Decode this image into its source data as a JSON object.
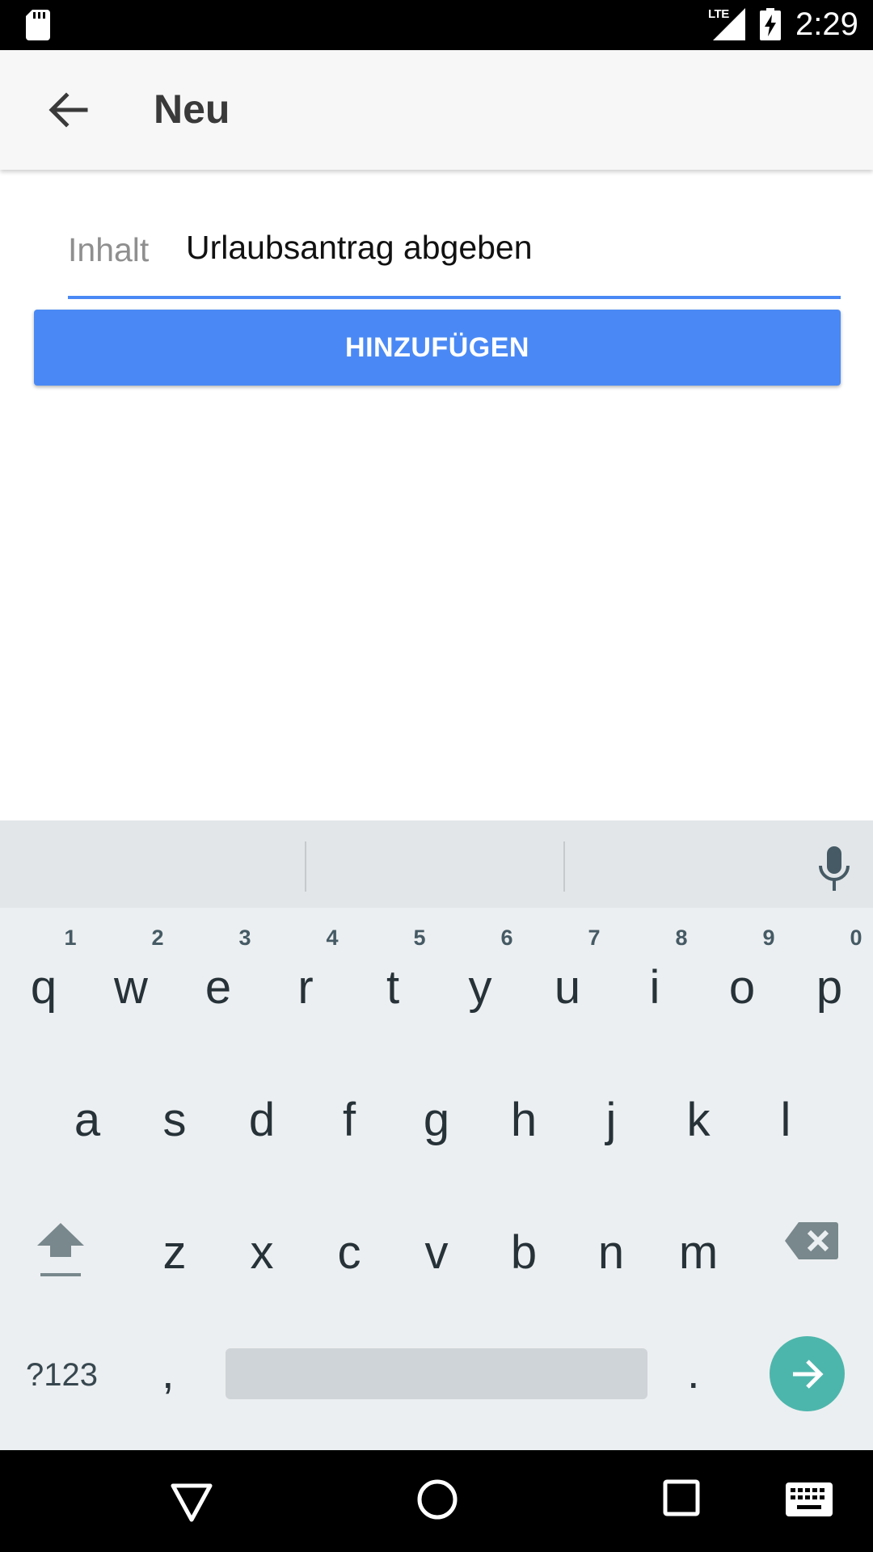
{
  "status_bar": {
    "network": "LTE",
    "time": "2:29",
    "icons": [
      "sd-card-icon",
      "signal-icon",
      "battery-charging-icon"
    ]
  },
  "app_bar": {
    "title": "Neu",
    "back_icon": "arrow-back-icon"
  },
  "form": {
    "field_label": "Inhalt",
    "field_value": "Urlaubsantrag abgeben",
    "submit_label": "HINZUFÜGEN",
    "accent_color": "#4a89f5"
  },
  "keyboard": {
    "row1": [
      {
        "key": "q",
        "hint": "1"
      },
      {
        "key": "w",
        "hint": "2"
      },
      {
        "key": "e",
        "hint": "3"
      },
      {
        "key": "r",
        "hint": "4"
      },
      {
        "key": "t",
        "hint": "5"
      },
      {
        "key": "y",
        "hint": "6"
      },
      {
        "key": "u",
        "hint": "7"
      },
      {
        "key": "i",
        "hint": "8"
      },
      {
        "key": "o",
        "hint": "9"
      },
      {
        "key": "p",
        "hint": "0"
      }
    ],
    "row2": [
      "a",
      "s",
      "d",
      "f",
      "g",
      "h",
      "j",
      "k",
      "l"
    ],
    "row3": [
      "z",
      "x",
      "c",
      "v",
      "b",
      "n",
      "m"
    ],
    "symbols_label": "?123",
    "comma": ",",
    "period": ".",
    "enter_color": "#4db6ac"
  },
  "nav_bar": {
    "icons": [
      "nav-back-icon",
      "nav-home-icon",
      "nav-recents-icon",
      "nav-keyboard-icon"
    ]
  }
}
